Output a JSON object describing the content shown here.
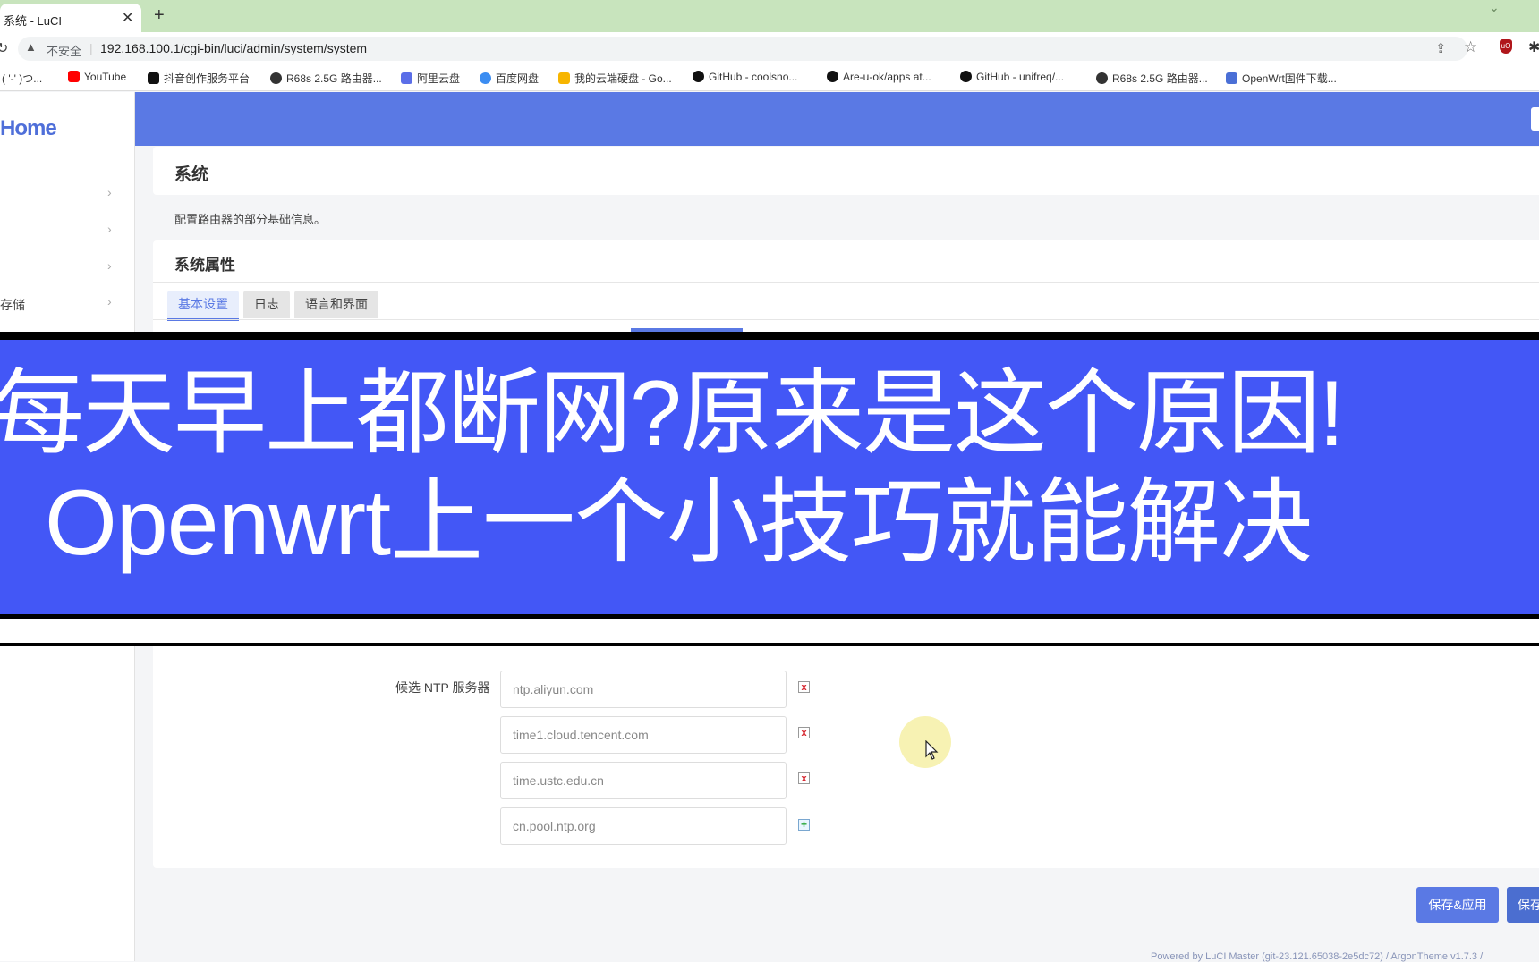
{
  "browser": {
    "tab_title": "系统 - LuCI",
    "tab_close": "✕",
    "new_tab": "+",
    "insecure_label": "不安全",
    "url": "192.168.100.1/cgi-bin/luci/admin/system/system",
    "bookmarks": [
      {
        "label": "( '-' )つ...",
        "icon": "kaomoji",
        "color": "#ffffff"
      },
      {
        "label": "YouTube",
        "icon": "youtube-icon",
        "color": "#ff0000"
      },
      {
        "label": "抖音创作服务平台",
        "icon": "douyin-icon",
        "color": "#111111"
      },
      {
        "label": "R68s 2.5G 路由器...",
        "icon": "globe-icon",
        "color": "#333333"
      },
      {
        "label": "阿里云盘",
        "icon": "aliyun-icon",
        "color": "#5b6ee8"
      },
      {
        "label": "百度网盘",
        "icon": "baidu-icon",
        "color": "#3b8df2"
      },
      {
        "label": "我的云端硬盘 - Go...",
        "icon": "gdrive-icon",
        "color": "#f7b500"
      },
      {
        "label": "GitHub - coolsno...",
        "icon": "github-icon",
        "color": "#111111"
      },
      {
        "label": "Are-u-ok/apps at...",
        "icon": "github-icon",
        "color": "#111111"
      },
      {
        "label": "GitHub - unifreq/...",
        "icon": "github-icon",
        "color": "#111111"
      },
      {
        "label": "R68s 2.5G 路由器...",
        "icon": "globe-icon",
        "color": "#333333"
      },
      {
        "label": "OpenWrt固件下载...",
        "icon": "openwrt-icon",
        "color": "#4a6fd6"
      }
    ]
  },
  "sidebar": {
    "brand": "Home",
    "storage_item": "存储"
  },
  "page": {
    "title": "系统",
    "description": "配置路由器的部分基础信息。",
    "section_title": "系统属性",
    "tabs": [
      "基本设置",
      "日志",
      "语言和界面"
    ]
  },
  "overlay": {
    "line1": "每天早上都断网?原来是这个原因!",
    "line2": "Openwrt上一个小技巧就能解决"
  },
  "ntp": {
    "label": "候选 NTP 服务器",
    "servers": [
      "ntp.aliyun.com",
      "time1.cloud.tencent.com",
      "time.ustc.edu.cn",
      "cn.pool.ntp.org"
    ],
    "remove_symbol": "x",
    "add_symbol": "+"
  },
  "actions": {
    "save_apply": "保存&应用",
    "save": "保存"
  },
  "footer": "Powered by LuCI Master (git-23.121.65038-2e5dc72) / ArgonTheme v1.7.3 /",
  "colors": {
    "accent": "#5a79e4",
    "banner": "#4357f6",
    "tabstrip": "#c8e4bd"
  }
}
